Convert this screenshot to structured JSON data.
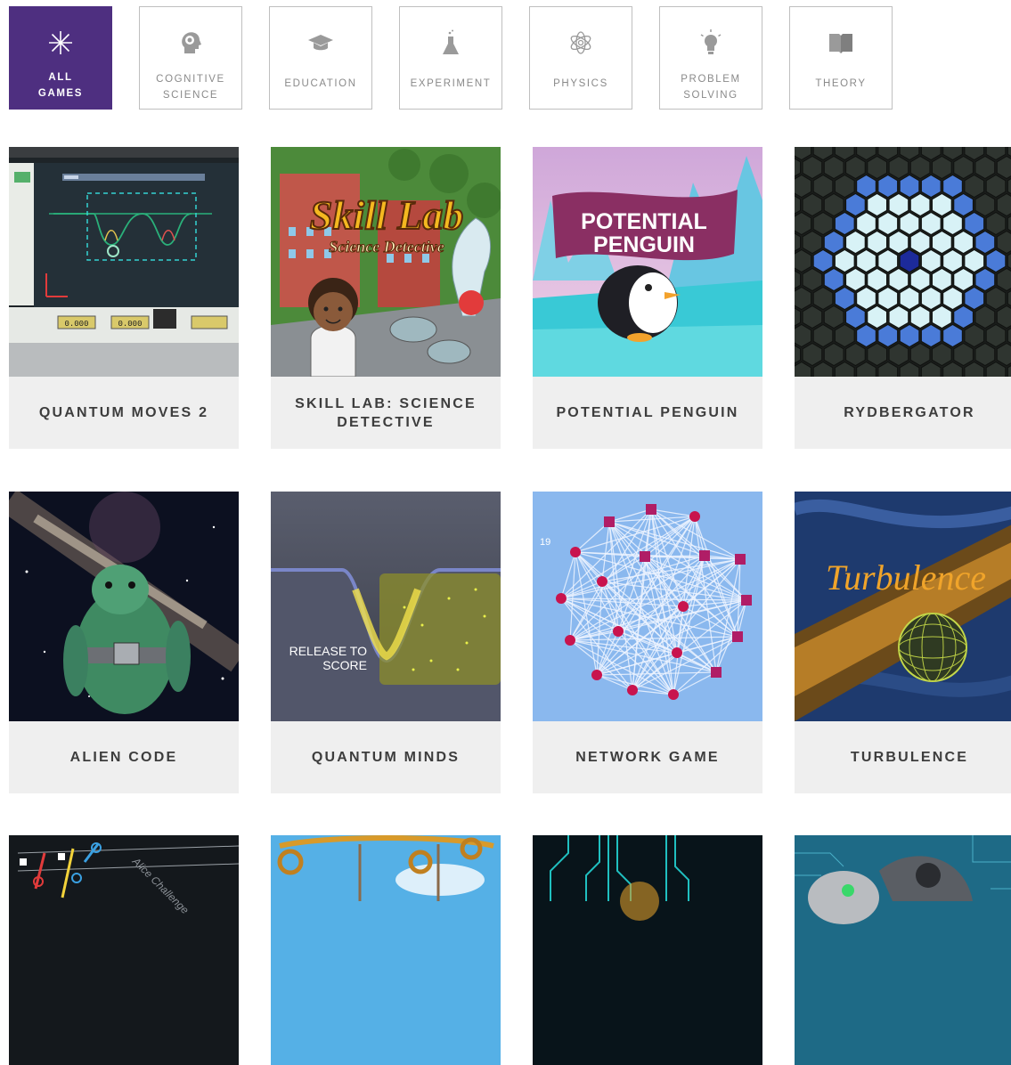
{
  "filters": [
    {
      "label_1": "ALL",
      "label_2": "GAMES",
      "icon": "asterisk-icon",
      "active": true
    },
    {
      "label_1": "COGNITIVE",
      "label_2": "SCIENCE",
      "icon": "brain-head-icon"
    },
    {
      "label_1": "EDUCATION",
      "icon": "graduation-cap-icon"
    },
    {
      "label_1": "EXPERIMENT",
      "icon": "flask-icon"
    },
    {
      "label_1": "PHYSICS",
      "icon": "atom-flower-icon"
    },
    {
      "label_1": "PROBLEM",
      "label_2": "SOLVING",
      "icon": "lightbulb-icon"
    },
    {
      "label_1": "THEORY",
      "icon": "book-icon"
    }
  ],
  "games": [
    {
      "title": "QUANTUM MOVES 2",
      "thumb_text": {
        "readout_a": "0.000",
        "readout_b": "0.000"
      }
    },
    {
      "title": "SKILL LAB: SCIENCE DETECTIVE",
      "thumb_text": {
        "logo_main": "Skill Lab",
        "logo_sub": "Science Detective"
      }
    },
    {
      "title": "POTENTIAL PENGUIN",
      "thumb_text": {
        "banner_1": "POTENTIAL",
        "banner_2": "PENGUIN"
      }
    },
    {
      "title": "RYDBERGATOR"
    },
    {
      "title": "ALIEN CODE"
    },
    {
      "title": "QUANTUM MINDS",
      "thumb_text": {
        "overlay_1": "RELEASE TO",
        "overlay_2": "SCORE"
      }
    },
    {
      "title": "NETWORK GAME",
      "thumb_text": {
        "counter": "19"
      }
    },
    {
      "title": "TURBULENCE",
      "thumb_text": {
        "logo": "Turbulence"
      }
    },
    {
      "title": "",
      "thumb_text": {
        "tag": "Alice Challenge"
      }
    },
    {
      "title": ""
    },
    {
      "title": ""
    },
    {
      "title": ""
    }
  ],
  "colors": {
    "accent": "#4e2f80",
    "card_bg": "#efefef",
    "title_text": "#3d3d3d"
  }
}
